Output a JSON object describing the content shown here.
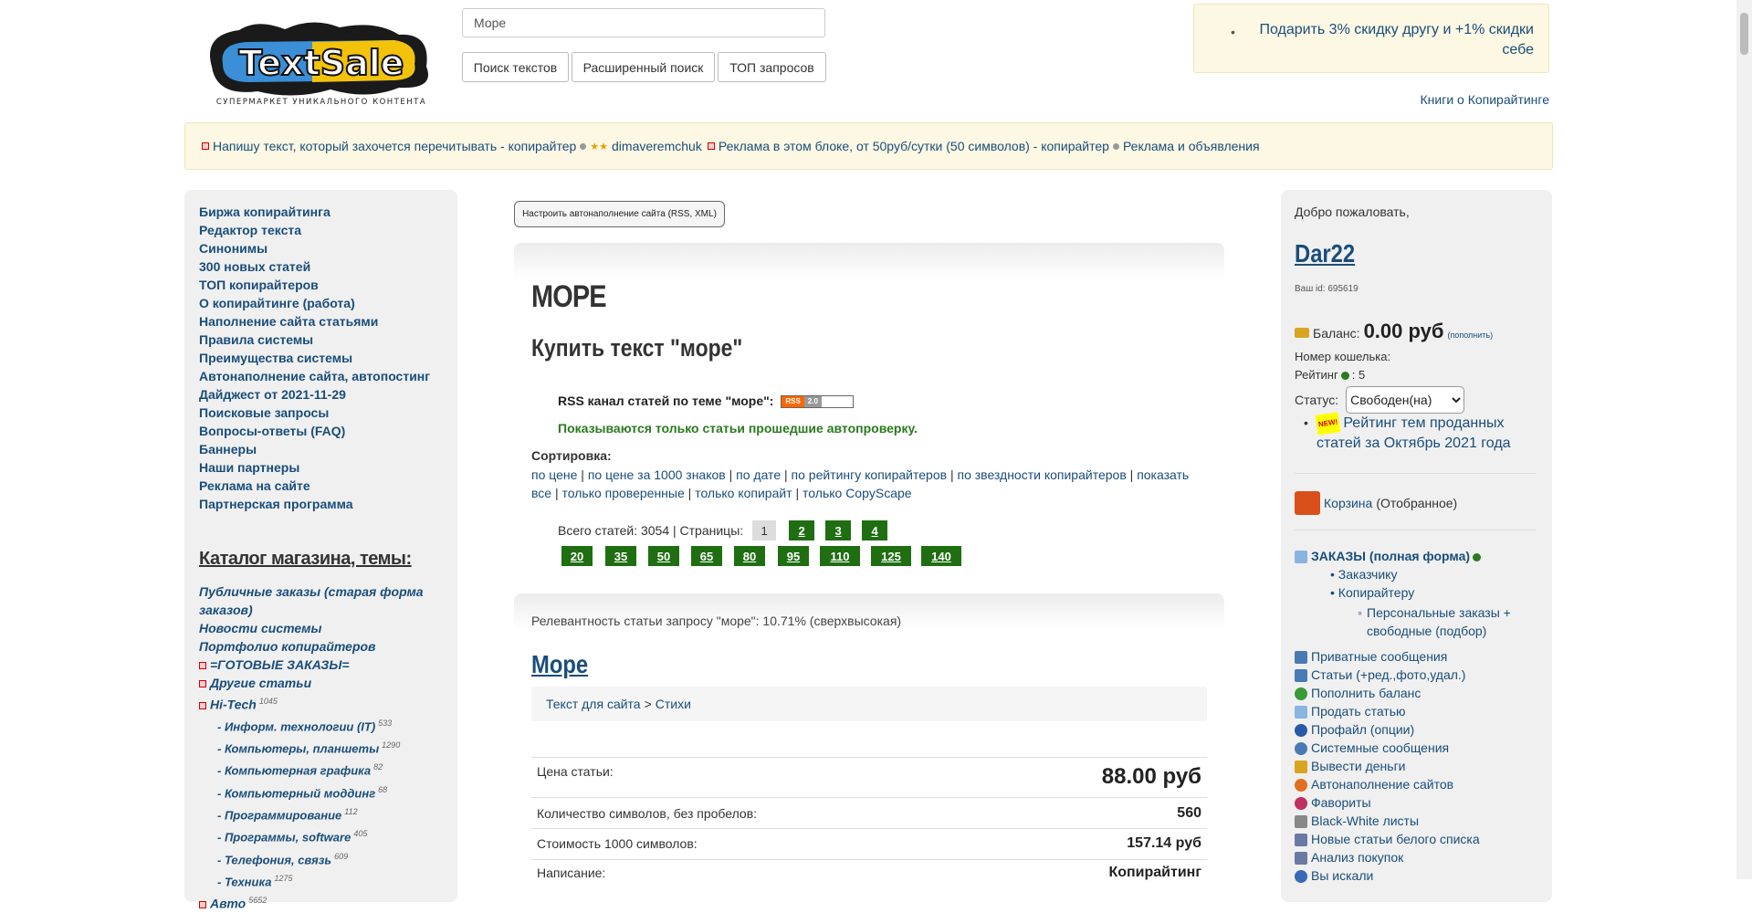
{
  "header": {
    "logo_text": "TextSale",
    "logo_tagline": "СУПЕРМАРКЕТ УНИКАЛЬНОГО КОНТЕНТА",
    "search_value": "Море",
    "buttons": [
      "Поиск текстов",
      "Расширенный поиск",
      "ТОП запросов"
    ],
    "promo": "Подарить 3% скидку другу и +1% скидки себе",
    "books_link": "Книги о Копирайтинге"
  },
  "ad_bar": {
    "item1": "Напишу текст, который захочется перечитывать - копирайтер",
    "user1": "dimaveremchuk",
    "item2": "Реклама в этом блоке, от 50руб/сутки (50 символов) - копирайтер",
    "item3": "Реклама и объявления"
  },
  "left_menu": [
    "Биржа копирайтинга",
    "Редактор текста",
    "Синонимы",
    "300 новых статей",
    "ТОП копирайтеров",
    "О копирайтинге (работа)",
    "Наполнение сайта статьями",
    "Правила системы",
    "Преимущества системы",
    "Автонаполнение сайта, автопостинг",
    "Дайджест от 2021-11-29",
    "Поисковые запросы",
    "Вопросы-ответы (FAQ)",
    "Баннеры",
    "Наши партнеры",
    "Реклама на сайте",
    "Партнерская программа"
  ],
  "catalog": {
    "title": "Каталог магазина, темы:",
    "top_items": [
      "Публичные заказы (старая форма заказов)",
      "Новости системы",
      "Портфолио копирайтеров"
    ],
    "ready_orders": "=ГОТОВЫЕ ЗАКАЗЫ=",
    "other": "Другие статьи",
    "hitech": {
      "label": "Hi-Tech",
      "count": "1045"
    },
    "subs": [
      {
        "label": "- Информ. технологии (IT)",
        "count": "533"
      },
      {
        "label": "- Компьютеры, планшеты",
        "count": "1290"
      },
      {
        "label": "- Компьютерная графика",
        "count": "82"
      },
      {
        "label": "- Компьютерный моддинг",
        "count": "68"
      },
      {
        "label": "- Программирование",
        "count": "112"
      },
      {
        "label": "- Программы, software",
        "count": "405"
      },
      {
        "label": "- Телефония, связь",
        "count": "609"
      },
      {
        "label": "- Техника",
        "count": "1275"
      }
    ],
    "auto": {
      "label": "Авто",
      "count": "5652"
    }
  },
  "center": {
    "rss_config": "Настроить автонаполнение сайта (RSS, XML)",
    "h1": "МОРЕ",
    "h2": "Купить текст \"море\"",
    "rss_line": "RSS канал статей по теме \"море\":",
    "rss_badge_left": "RSS",
    "rss_badge_right": "2.0",
    "verified": "Показываются только статьи прошедшие автопроверку.",
    "sort_label": "Сортировка:",
    "sort_links": [
      "по цене",
      "по цене за 1000 знаков",
      "по дате",
      "по рейтингу копирайтеров",
      "по звездности копирайтеров",
      "показать все",
      "только проверенные",
      "только копирайт",
      "только CopyScape"
    ],
    "total_text": "Всего статей: 3054 | Страницы:",
    "pages": [
      "1",
      "2",
      "3",
      "4"
    ],
    "per_page": [
      "20",
      "35",
      "50",
      "65",
      "80",
      "95",
      "110",
      "125",
      "140"
    ],
    "relevance": "Релевантность статьи запросу \"море\": 10.71% (сверхвысокая)",
    "article_title": "Море",
    "crumb1": "Текст для сайта",
    "crumb_sep": ">",
    "crumb2": "Стихи",
    "rows": [
      {
        "k": "Цена статьи:",
        "v": "88.00 руб"
      },
      {
        "k": "Количество символов, без пробелов:",
        "v": "560"
      },
      {
        "k": "Стоимость 1000 символов:",
        "v": "157.14 руб"
      },
      {
        "k": "Написание:",
        "v": "Копирайтинг"
      }
    ]
  },
  "right": {
    "welcome": "Добро пожаловать,",
    "username": "Dar22",
    "user_id": "Ваш id: 695619",
    "balance_label": "Баланс:",
    "balance_amount": "0.00 руб",
    "topup": "(пополнить)",
    "wallet": "Номер кошелька:",
    "rating_label": "Рейтинг",
    "rating_value": ": 5",
    "status_label": "Статус:",
    "status_value": "Свободен(на)",
    "new_badge": "NEW!",
    "rating_link": "Рейтинг тем проданных статей за Октябрь 2021 года",
    "cart_link": "Корзина",
    "cart_tail": "(Отобранное)",
    "orders": "ЗАКАЗЫ (полная форма)",
    "orders_sub": [
      "Заказчику",
      "Копирайтеру"
    ],
    "orders_sub2": "Персональные заказы + свободные (подбор)",
    "menu": [
      "Приватные сообщения",
      "Статьи (+ред.,фото,удал.)",
      "Пополнить баланс",
      "Продать статью",
      "Профайл (опции)",
      "Системные сообщения",
      "Вывести деньги",
      "Автонаполнение сайтов",
      "Фавориты",
      "Black-White листы",
      "Новые статьи белого списка",
      "Анализ покупок",
      "Вы искали"
    ],
    "menu_colors": [
      "#4a7ab5",
      "#4a7ab5",
      "#3a9a3a",
      "#8ab4e0",
      "#2a5aa5",
      "#4a7ab5",
      "#d9a520",
      "#e07020",
      "#c03060",
      "#888",
      "#6a7aa5",
      "#6a7aa5",
      "#3a6ab5"
    ]
  }
}
